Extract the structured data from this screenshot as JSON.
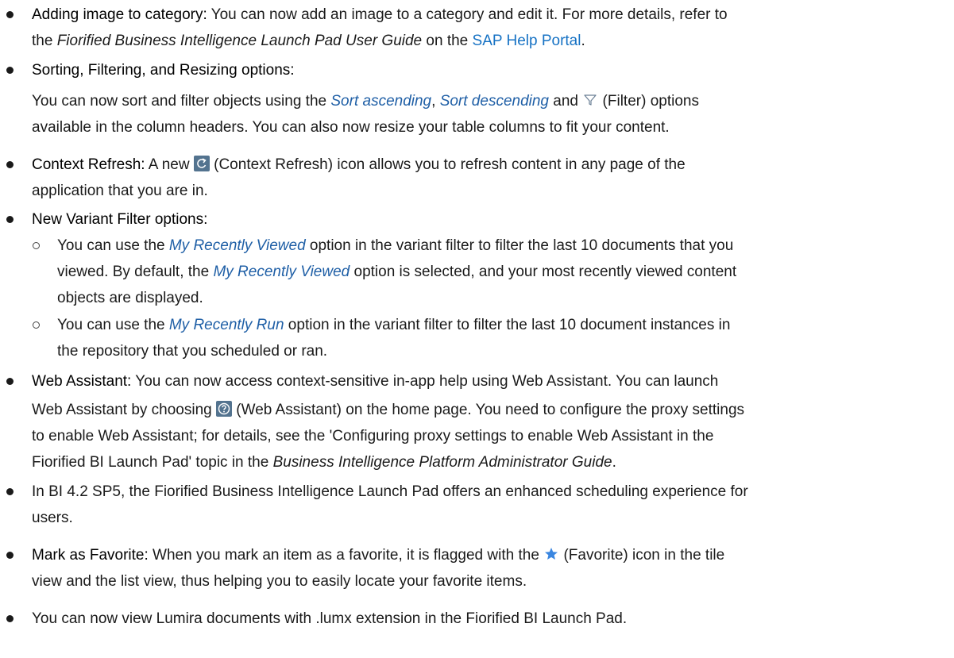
{
  "items": [
    {
      "term": "Adding image to category:",
      "text1": " You can now add an image to a category and edit it. For more details, refer to",
      "text2_em": "the Fiorified Business Intelligence Launch Pad User Guide",
      "text2_em_prefix": "the ",
      "text2_em_body": "Fiorified Business Intelligence Launch Pad User Guide",
      "text2_mid": " on the ",
      "link": "SAP Help Portal",
      "text2_end": "."
    },
    {
      "term": "Sorting, Filtering, and Resizing options:",
      "p1_a": "You can now sort and filter objects using the ",
      "p1_sort_asc": "Sort ascending",
      "p1_comma": ", ",
      "p1_sort_desc": "Sort descending",
      "p1_b": " and ",
      "p1_c": " (Filter) options",
      "p2": "available in the column headers. You can also now resize your table columns to fit your content."
    },
    {
      "term": "Context Refresh:",
      "a": " A new ",
      "b": " (Context Refresh) icon allows you to refresh content in any page of the",
      "line2": "application that you are in."
    },
    {
      "term": "New Variant Filter options:",
      "sub": [
        {
          "l1a": "You can use the ",
          "l1em": "My Recently Viewed",
          "l1b": " option in the variant filter to filter the last 10 documents that you",
          "l2a": "viewed. By default, the ",
          "l2em": "My Recently Viewed",
          "l2b": " option is selected, and your most recently viewed content",
          "l3": "objects are displayed."
        },
        {
          "l1a": "You can use the ",
          "l1em": "My Recently Run",
          "l1b": " option in the variant filter to filter the last 10 document instances in",
          "l2": "the repository that you scheduled or ran."
        }
      ]
    },
    {
      "term": "Web Assistant:",
      "l1": " You can now access context-sensitive in-app help using Web Assistant. You can launch",
      "l2a": "Web Assistant by choosing ",
      "l2b": " (Web Assistant) on the home page. You need to configure the proxy settings",
      "l3": "to enable Web Assistant; for details, see the 'Configuring proxy settings to enable Web Assistant in the",
      "l4a": "Fiorified BI Launch Pad' topic in the ",
      "l4em": "Business Intelligence Platform Administrator Guide",
      "l4b": "."
    },
    {
      "l1": "In BI 4.2 SP5, the Fiorified Business Intelligence Launch Pad offers an enhanced scheduling experience for",
      "l2": "users."
    },
    {
      "term": "Mark as Favorite:",
      "l1a": " When you mark an item as a favorite, it is flagged with the ",
      "l1b": " (Favorite) icon in the tile",
      "l2": "view and the list view, thus helping you to easily locate your favorite items."
    },
    {
      "l1": "You can now view Lumira documents with .lumx extension in the Fiorified BI Launch Pad."
    }
  ],
  "colors": {
    "link": "#1672c4",
    "emphasis": "#1f5fa6",
    "icon_bg": "#53738f",
    "favorite": "#3a86e0"
  },
  "icons": [
    "filter-icon",
    "context-refresh-icon",
    "web-assistant-icon",
    "favorite-star-icon"
  ]
}
